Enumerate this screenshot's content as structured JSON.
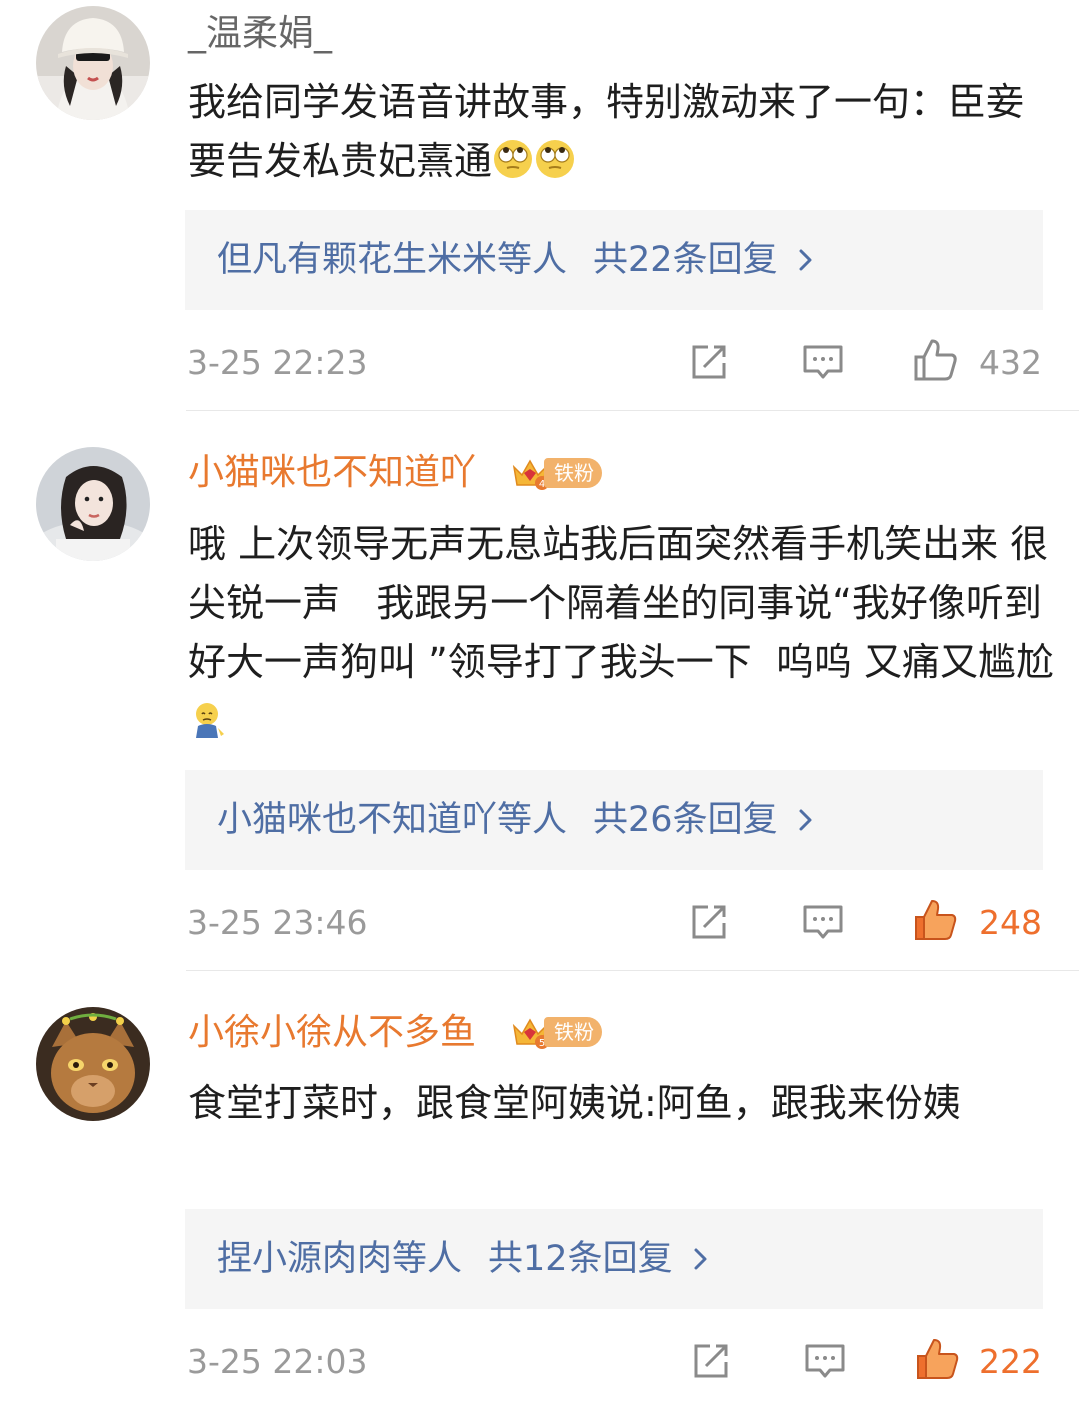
{
  "comments": [
    {
      "username": "_温柔娟_",
      "user_style": "plain",
      "text": "我给同学发语音讲故事，特别激动来了一句：臣妾要告发私贵妃熹通",
      "emojis": [
        "eye-roll-emoji",
        "eye-roll-emoji"
      ],
      "replies": {
        "who": "但凡有颗花生米米",
        "mid": "等人",
        "total": "共22条回复"
      },
      "time": "3-25 22:23",
      "likes": "432",
      "liked": false
    },
    {
      "username": "小猫咪也不知道吖",
      "user_style": "vip",
      "badge_label": "铁粉",
      "badge_level": "4",
      "text": "哦 上次领导无声无息站我后面突然看手机笑出来 很尖锐一声   我跟另一个隔着坐的同事说“我好像听到好大一声狗叫 ”领导打了我头一下  呜呜 又痛又尴尬",
      "emojis": [
        "sad-sitting-emoji"
      ],
      "replies": {
        "who": "小猫咪也不知道吖",
        "mid": "等人",
        "total": "共26条回复"
      },
      "time": "3-25 23:46",
      "likes": "248",
      "liked": true
    },
    {
      "username": "小徐小徐从不多鱼",
      "user_style": "vip",
      "badge_label": "铁粉",
      "badge_level": "5",
      "text": "食堂打菜时，跟食堂阿姨说:阿鱼，跟我来份姨",
      "emojis": [],
      "replies": {
        "who": "捏小源肉肉",
        "mid": "等人",
        "total": "共12条回复"
      },
      "time": "3-25 22:03",
      "likes": "222",
      "liked": true
    }
  ],
  "colors": {
    "link_blue": "#4f6ea4",
    "vip_orange": "#e8792f",
    "like_orange": "#ee6f2d",
    "meta_grey": "#9a9a9a",
    "reply_bg": "#f5f5f5"
  },
  "icons": [
    "share-icon",
    "comment-icon",
    "like-icon",
    "chevron-right-icon",
    "crown-icon"
  ]
}
